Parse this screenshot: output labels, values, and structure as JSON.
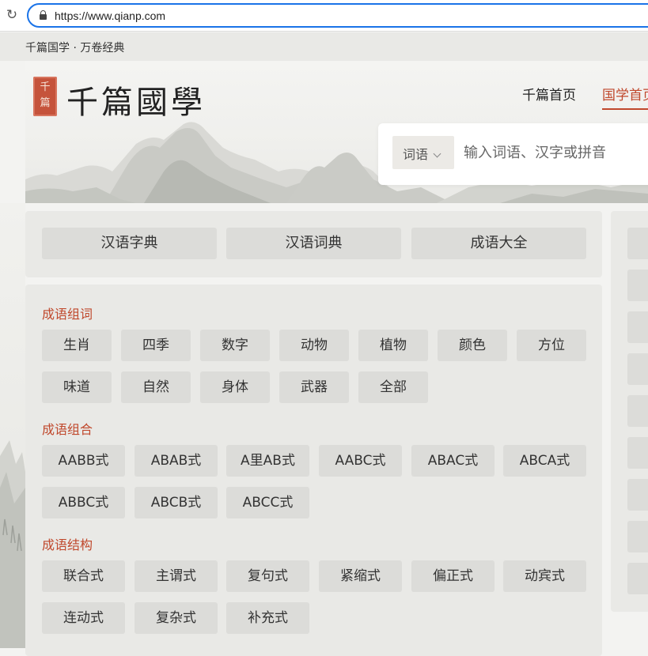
{
  "browser": {
    "url": "https://www.qianp.com"
  },
  "topstrip": {
    "text": "千篇国学 · 万卷经典"
  },
  "header": {
    "seal": [
      "千",
      "篇"
    ],
    "brand": "千篇國學",
    "nav": {
      "home": "千篇首页",
      "guoxue": "国学首页"
    },
    "search": {
      "select_label": "词语",
      "placeholder": "输入词语、汉字或拼音"
    }
  },
  "quicklinks": [
    "汉语字典",
    "汉语词典",
    "成语大全"
  ],
  "sections": [
    {
      "title": "成语组词",
      "items": [
        "生肖",
        "四季",
        "数字",
        "动物",
        "植物",
        "颜色",
        "方位",
        "味道",
        "自然",
        "身体",
        "武器",
        "全部"
      ]
    },
    {
      "title": "成语组合",
      "items": [
        "AABB式",
        "ABAB式",
        "A里AB式",
        "AABC式",
        "ABAC式",
        "ABCA式",
        "ABBC式",
        "ABCB式",
        "ABCC式"
      ]
    },
    {
      "title": "成语结构",
      "items": [
        "联合式",
        "主谓式",
        "复句式",
        "紧缩式",
        "偏正式",
        "动宾式",
        "连动式",
        "复杂式",
        "补充式"
      ]
    }
  ]
}
